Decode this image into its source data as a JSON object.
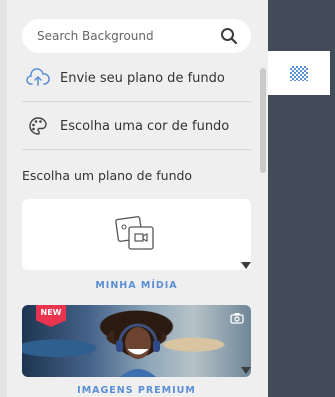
{
  "search": {
    "placeholder": "Search Background"
  },
  "options": [
    {
      "label": "Envie seu plano de fundo",
      "icon": "cloud-upload-icon"
    },
    {
      "label": "Escolha uma cor de fundo",
      "icon": "palette-icon"
    }
  ],
  "section_title": "Escolha um plano de fundo",
  "cards": [
    {
      "label": "MINHA MÍDIA",
      "icon": "media-files-icon"
    },
    {
      "label": "IMAGENS PREMIUM",
      "badge": "NEW",
      "icon": "camera-icon"
    }
  ],
  "colors": {
    "accent": "#5b8fd6",
    "rail": "#424c59",
    "badge": "#e8344e"
  }
}
